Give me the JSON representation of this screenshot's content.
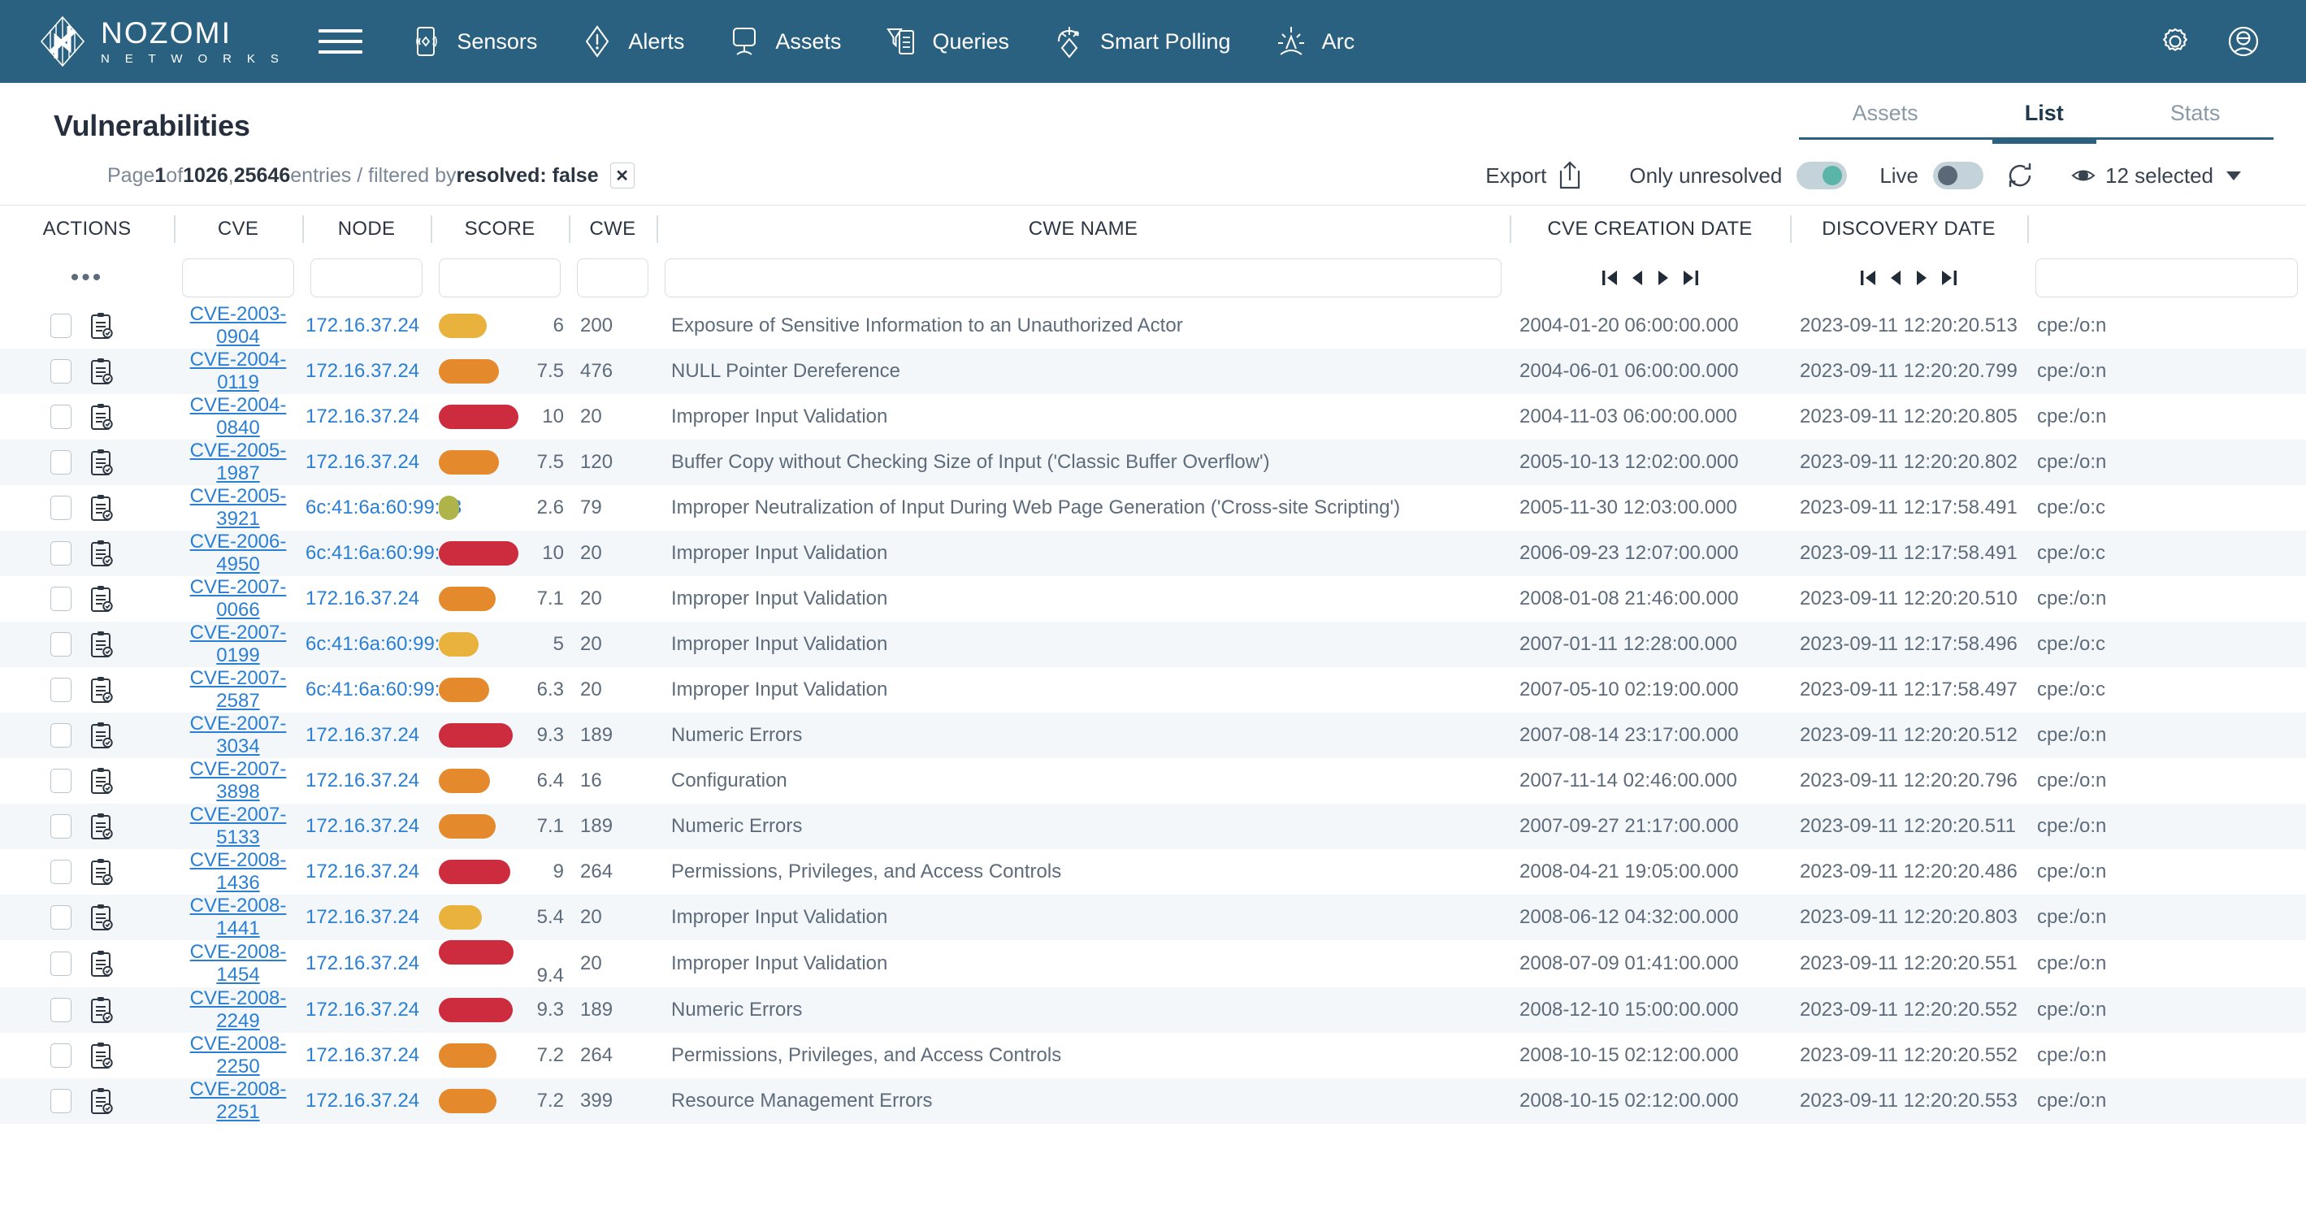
{
  "nav": {
    "brand": {
      "line1": "NOZOMI",
      "line2": "N E T W O R K S"
    },
    "menu_icon": "hamburger-icon",
    "items": [
      {
        "label": "Sensors",
        "icon": "sensors-icon"
      },
      {
        "label": "Alerts",
        "icon": "alerts-icon"
      },
      {
        "label": "Assets",
        "icon": "assets-icon"
      },
      {
        "label": "Queries",
        "icon": "queries-icon"
      },
      {
        "label": "Smart Polling",
        "icon": "smart-polling-icon"
      },
      {
        "label": "Arc",
        "icon": "arc-icon"
      }
    ],
    "right_icons": [
      {
        "name": "settings-gear-icon"
      },
      {
        "name": "user-account-icon"
      }
    ]
  },
  "header": {
    "title": "Vulnerabilities",
    "tabs": [
      {
        "label": "Assets",
        "active": false
      },
      {
        "label": "List",
        "active": true
      },
      {
        "label": "Stats",
        "active": false
      }
    ]
  },
  "subheader": {
    "page_prefix": "Page ",
    "page_current": "1",
    "page_of": " of ",
    "page_total": "1026",
    "comma": ", ",
    "entries_count": "25646",
    "entries_label": " entries / filtered by ",
    "filter_text": "resolved: false",
    "clear_filter": "✕",
    "export_label": "Export",
    "only_unresolved_label": "Only unresolved",
    "only_unresolved_on": true,
    "live_label": "Live",
    "live_on": false,
    "selected_label": "12 selected"
  },
  "table": {
    "columns": [
      "ACTIONS",
      "CVE",
      "NODE",
      "SCORE",
      "CWE",
      "CWE NAME",
      "CVE CREATION DATE",
      "DISCOVERY DATE",
      ""
    ],
    "actions_more": "•••",
    "rows": [
      {
        "cve": "CVE-2003-0904",
        "node": "172.16.37.24",
        "score": "6",
        "score_num": 6.0,
        "color": "#e8b23c",
        "cwe": "200",
        "cwe_name": "Exposure of Sensitive Information to an Unauthorized Actor",
        "created": "2004-01-20 06:00:00.000",
        "discovered": "2023-09-11 12:20:20.513",
        "cpe": "cpe:/o:n"
      },
      {
        "cve": "CVE-2004-0119",
        "node": "172.16.37.24",
        "score": "7.5",
        "score_num": 7.5,
        "color": "#e5892d",
        "cwe": "476",
        "cwe_name": "NULL Pointer Dereference",
        "created": "2004-06-01 06:00:00.000",
        "discovered": "2023-09-11 12:20:20.799",
        "cpe": "cpe:/o:n"
      },
      {
        "cve": "CVE-2004-0840",
        "node": "172.16.37.24",
        "score": "10",
        "score_num": 10.0,
        "color": "#cc2c3d",
        "cwe": "20",
        "cwe_name": "Improper Input Validation",
        "created": "2004-11-03 06:00:00.000",
        "discovered": "2023-09-11 12:20:20.805",
        "cpe": "cpe:/o:n"
      },
      {
        "cve": "CVE-2005-1987",
        "node": "172.16.37.24",
        "score": "7.5",
        "score_num": 7.5,
        "color": "#e5892d",
        "cwe": "120",
        "cwe_name": "Buffer Copy without Checking Size of Input ('Classic Buffer Overflow')",
        "created": "2005-10-13 12:02:00.000",
        "discovered": "2023-09-11 12:20:20.802",
        "cpe": "cpe:/o:n"
      },
      {
        "cve": "CVE-2005-3921",
        "node": "6c:41:6a:60:99:23",
        "score": "2.6",
        "score_num": 2.6,
        "color": "#aeb34a",
        "cwe": "79",
        "cwe_name": "Improper Neutralization of Input During Web Page Generation ('Cross-site Scripting')",
        "created": "2005-11-30 12:03:00.000",
        "discovered": "2023-09-11 12:17:58.491",
        "cpe": "cpe:/o:c"
      },
      {
        "cve": "CVE-2006-4950",
        "node": "6c:41:6a:60:99:23",
        "score": "10",
        "score_num": 10.0,
        "color": "#cc2c3d",
        "cwe": "20",
        "cwe_name": "Improper Input Validation",
        "created": "2006-09-23 12:07:00.000",
        "discovered": "2023-09-11 12:17:58.491",
        "cpe": "cpe:/o:c"
      },
      {
        "cve": "CVE-2007-0066",
        "node": "172.16.37.24",
        "score": "7.1",
        "score_num": 7.1,
        "color": "#e5892d",
        "cwe": "20",
        "cwe_name": "Improper Input Validation",
        "created": "2008-01-08 21:46:00.000",
        "discovered": "2023-09-11 12:20:20.510",
        "cpe": "cpe:/o:n"
      },
      {
        "cve": "CVE-2007-0199",
        "node": "6c:41:6a:60:99:23",
        "score": "5",
        "score_num": 5.0,
        "color": "#e8b23c",
        "cwe": "20",
        "cwe_name": "Improper Input Validation",
        "created": "2007-01-11 12:28:00.000",
        "discovered": "2023-09-11 12:17:58.496",
        "cpe": "cpe:/o:c"
      },
      {
        "cve": "CVE-2007-2587",
        "node": "6c:41:6a:60:99:23",
        "score": "6.3",
        "score_num": 6.3,
        "color": "#e5892d",
        "cwe": "20",
        "cwe_name": "Improper Input Validation",
        "created": "2007-05-10 02:19:00.000",
        "discovered": "2023-09-11 12:17:58.497",
        "cpe": "cpe:/o:c"
      },
      {
        "cve": "CVE-2007-3034",
        "node": "172.16.37.24",
        "score": "9.3",
        "score_num": 9.3,
        "color": "#cc2c3d",
        "cwe": "189",
        "cwe_name": "Numeric Errors",
        "created": "2007-08-14 23:17:00.000",
        "discovered": "2023-09-11 12:20:20.512",
        "cpe": "cpe:/o:n"
      },
      {
        "cve": "CVE-2007-3898",
        "node": "172.16.37.24",
        "score": "6.4",
        "score_num": 6.4,
        "color": "#e5892d",
        "cwe": "16",
        "cwe_name": "Configuration",
        "created": "2007-11-14 02:46:00.000",
        "discovered": "2023-09-11 12:20:20.796",
        "cpe": "cpe:/o:n"
      },
      {
        "cve": "CVE-2007-5133",
        "node": "172.16.37.24",
        "score": "7.1",
        "score_num": 7.1,
        "color": "#e5892d",
        "cwe": "189",
        "cwe_name": "Numeric Errors",
        "created": "2007-09-27 21:17:00.000",
        "discovered": "2023-09-11 12:20:20.511",
        "cpe": "cpe:/o:n"
      },
      {
        "cve": "CVE-2008-1436",
        "node": "172.16.37.24",
        "score": "9",
        "score_num": 9.0,
        "color": "#cc2c3d",
        "cwe": "264",
        "cwe_name": "Permissions, Privileges, and Access Controls",
        "created": "2008-04-21 19:05:00.000",
        "discovered": "2023-09-11 12:20:20.486",
        "cpe": "cpe:/o:n"
      },
      {
        "cve": "CVE-2008-1441",
        "node": "172.16.37.24",
        "score": "5.4",
        "score_num": 5.4,
        "color": "#e8b23c",
        "cwe": "20",
        "cwe_name": "Improper Input Validation",
        "created": "2008-06-12 04:32:00.000",
        "discovered": "2023-09-11 12:20:20.803",
        "cpe": "cpe:/o:n"
      },
      {
        "cve": "CVE-2008-1454",
        "node": "172.16.37.24",
        "score": "9.4",
        "score_num": 9.4,
        "color": "#cc2c3d",
        "cwe": "20",
        "cwe_name": "Improper Input Validation",
        "created": "2008-07-09 01:41:00.000",
        "discovered": "2023-09-11 12:20:20.551",
        "cpe": "cpe:/o:n",
        "wrap": true
      },
      {
        "cve": "CVE-2008-2249",
        "node": "172.16.37.24",
        "score": "9.3",
        "score_num": 9.3,
        "color": "#cc2c3d",
        "cwe": "189",
        "cwe_name": "Numeric Errors",
        "created": "2008-12-10 15:00:00.000",
        "discovered": "2023-09-11 12:20:20.552",
        "cpe": "cpe:/o:n"
      },
      {
        "cve": "CVE-2008-2250",
        "node": "172.16.37.24",
        "score": "7.2",
        "score_num": 7.2,
        "color": "#e5892d",
        "cwe": "264",
        "cwe_name": "Permissions, Privileges, and Access Controls",
        "created": "2008-10-15 02:12:00.000",
        "discovered": "2023-09-11 12:20:20.552",
        "cpe": "cpe:/o:n"
      },
      {
        "cve": "CVE-2008-2251",
        "node": "172.16.37.24",
        "score": "7.2",
        "score_num": 7.2,
        "color": "#e5892d",
        "cwe": "399",
        "cwe_name": "Resource Management Errors",
        "created": "2008-10-15 02:12:00.000",
        "discovered": "2023-09-11 12:20:20.553",
        "cpe": "cpe:/o:n"
      }
    ]
  },
  "colors": {
    "nav_bg": "#2b6180",
    "link": "#2a7fd4",
    "accent": "#2b6180",
    "score_low": "#aeb34a",
    "score_medium": "#e8b23c",
    "score_high": "#e5892d",
    "score_critical": "#cc2c3d",
    "toggle_on": "#5ab5a8",
    "toggle_off": "#5a6877"
  }
}
